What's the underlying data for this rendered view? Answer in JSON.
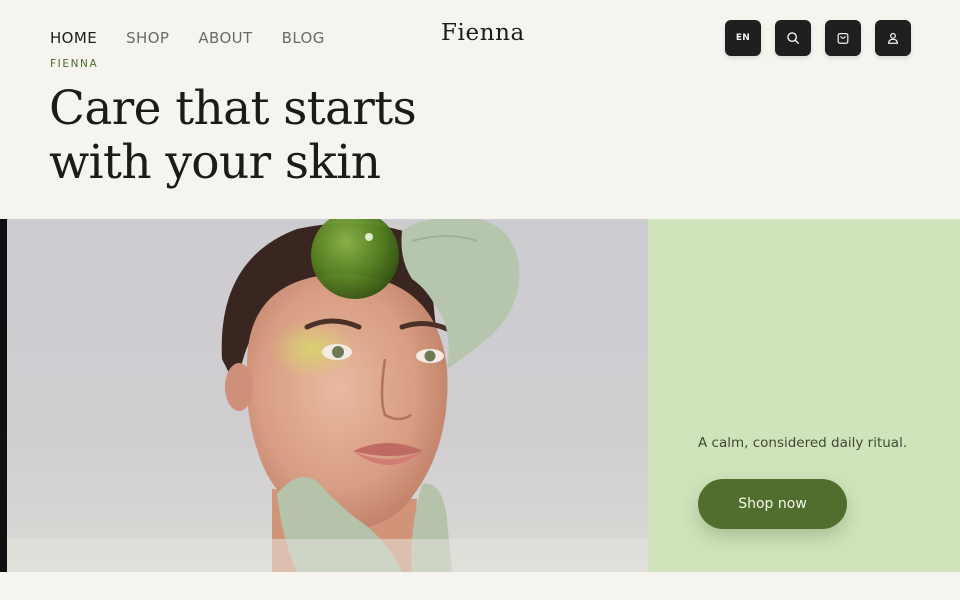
{
  "header": {
    "nav": [
      {
        "label": "HOME",
        "active": true
      },
      {
        "label": "SHOP",
        "active": false
      },
      {
        "label": "ABOUT",
        "active": false
      },
      {
        "label": "BLOG",
        "active": false
      }
    ],
    "brand": "Fienna",
    "icons": [
      {
        "name": "language",
        "label": "EN"
      },
      {
        "name": "search-icon"
      },
      {
        "name": "bag-icon"
      },
      {
        "name": "user-icon"
      }
    ]
  },
  "hero": {
    "eyebrow": "FIENNA",
    "headline_line1": "Care that starts",
    "headline_line2": "with your skin",
    "tagline": "A calm, considered daily ritual.",
    "cta_label": "Shop now"
  },
  "colors": {
    "background": "#f6f4ef",
    "accent_green": "#526e2e",
    "panel_green": "#d1e3bb",
    "icon_button": "#1f1f1f"
  }
}
